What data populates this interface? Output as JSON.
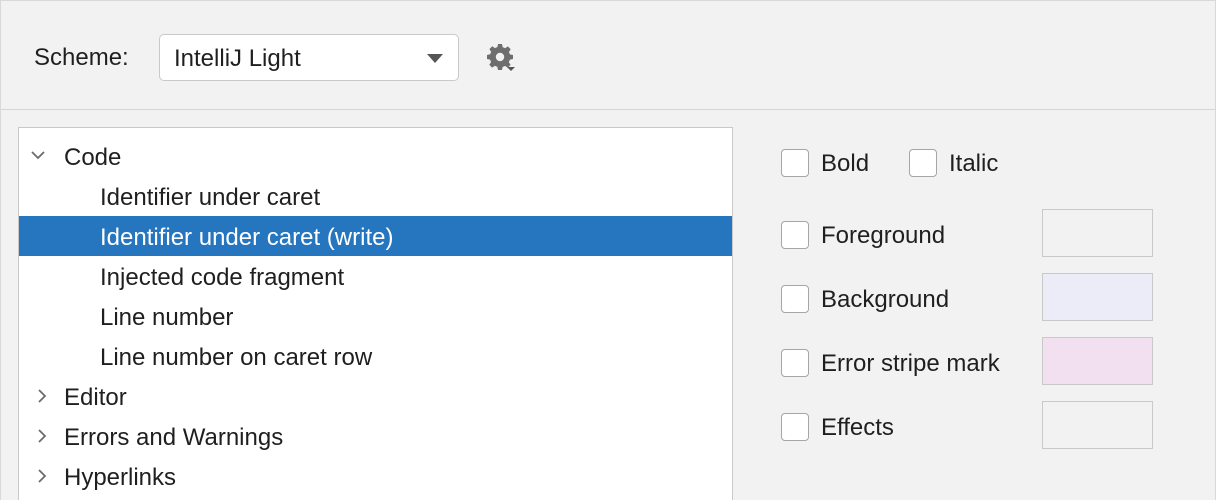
{
  "scheme": {
    "label": "Scheme:",
    "selected": "IntelliJ Light"
  },
  "tree": {
    "items": [
      {
        "label": "Code",
        "level": 0,
        "expanded": true,
        "selected": false
      },
      {
        "label": "Identifier under caret",
        "level": 1,
        "selected": false
      },
      {
        "label": "Identifier under caret (write)",
        "level": 1,
        "selected": true
      },
      {
        "label": "Injected code fragment",
        "level": 1,
        "selected": false
      },
      {
        "label": "Line number",
        "level": 1,
        "selected": false
      },
      {
        "label": "Line number on caret row",
        "level": 1,
        "selected": false
      },
      {
        "label": "Editor",
        "level": 0,
        "expanded": false,
        "selected": false
      },
      {
        "label": "Errors and Warnings",
        "level": 0,
        "expanded": false,
        "selected": false
      },
      {
        "label": "Hyperlinks",
        "level": 0,
        "expanded": false,
        "selected": false
      }
    ]
  },
  "options": {
    "bold": {
      "label": "Bold",
      "checked": false
    },
    "italic": {
      "label": "Italic",
      "checked": false
    },
    "foreground": {
      "label": "Foreground",
      "checked": false,
      "color": "#f2f2f2"
    },
    "background": {
      "label": "Background",
      "checked": false,
      "color": "#ecebf8"
    },
    "error_stripe": {
      "label": "Error stripe mark",
      "checked": false,
      "color": "#f2e0f0"
    },
    "effects": {
      "label": "Effects",
      "checked": false,
      "color": "#f2f2f2"
    }
  },
  "colors": {
    "selection": "#2675bf",
    "panel_background": "#f2f2f2"
  }
}
